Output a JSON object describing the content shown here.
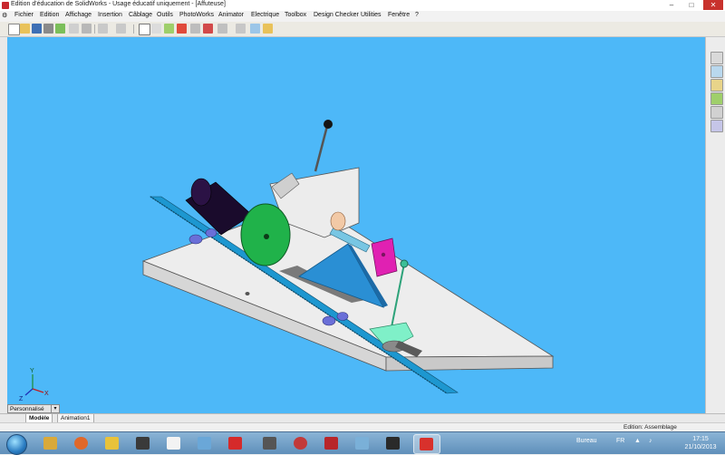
{
  "window": {
    "title": "Edition d'éducation de SolidWorks - Usage éducatif uniquement - [Affuteuse]",
    "minimize": "–",
    "maximize": "□",
    "close": "✕"
  },
  "menu": {
    "items": [
      "Fichier",
      "Edition",
      "Affichage",
      "Insertion",
      "Câblage",
      "Outils",
      "PhotoWorks",
      "Animator",
      "Electrique",
      "Toolbox",
      "Design Checker",
      "Utilities",
      "Fenêtre",
      "?"
    ]
  },
  "doc_controls": {
    "minimize": "–",
    "restore": "❐",
    "close": "✕"
  },
  "toolbar": {
    "icons": [
      "new-icon",
      "open-icon",
      "save-icon",
      "print-icon",
      "preview-icon",
      "undo-icon",
      "redo-icon",
      "select-icon",
      "rebuild-icon",
      "options-icon",
      "zoom-icon",
      "view-icon"
    ]
  },
  "viewport": {
    "background": "#4db8f8",
    "model_name": "Affuteuse",
    "triad": {
      "x": "X",
      "y": "Y",
      "z": "Z"
    }
  },
  "right_panel": {
    "icons": [
      "home-icon",
      "library-icon",
      "explorer-icon",
      "palette-icon",
      "appearance-icon",
      "custom-props-icon"
    ]
  },
  "view_selector": {
    "value": "Personnalisé"
  },
  "tabs": [
    {
      "label": "Modèle",
      "active": true
    },
    {
      "label": "Animation1",
      "active": false
    }
  ],
  "status": {
    "text": "Edition: Assemblage"
  },
  "taskbar": {
    "apps": [
      "windows-explorer",
      "firefox",
      "chrome",
      "files",
      "video",
      "document",
      "paint",
      "pdf",
      "tool",
      "media",
      "solidworks-red",
      "note",
      "monitor",
      "solidworks"
    ],
    "tray_label": "Bureau",
    "language": "FR",
    "time": "17:15",
    "date": "21/10/2013"
  }
}
